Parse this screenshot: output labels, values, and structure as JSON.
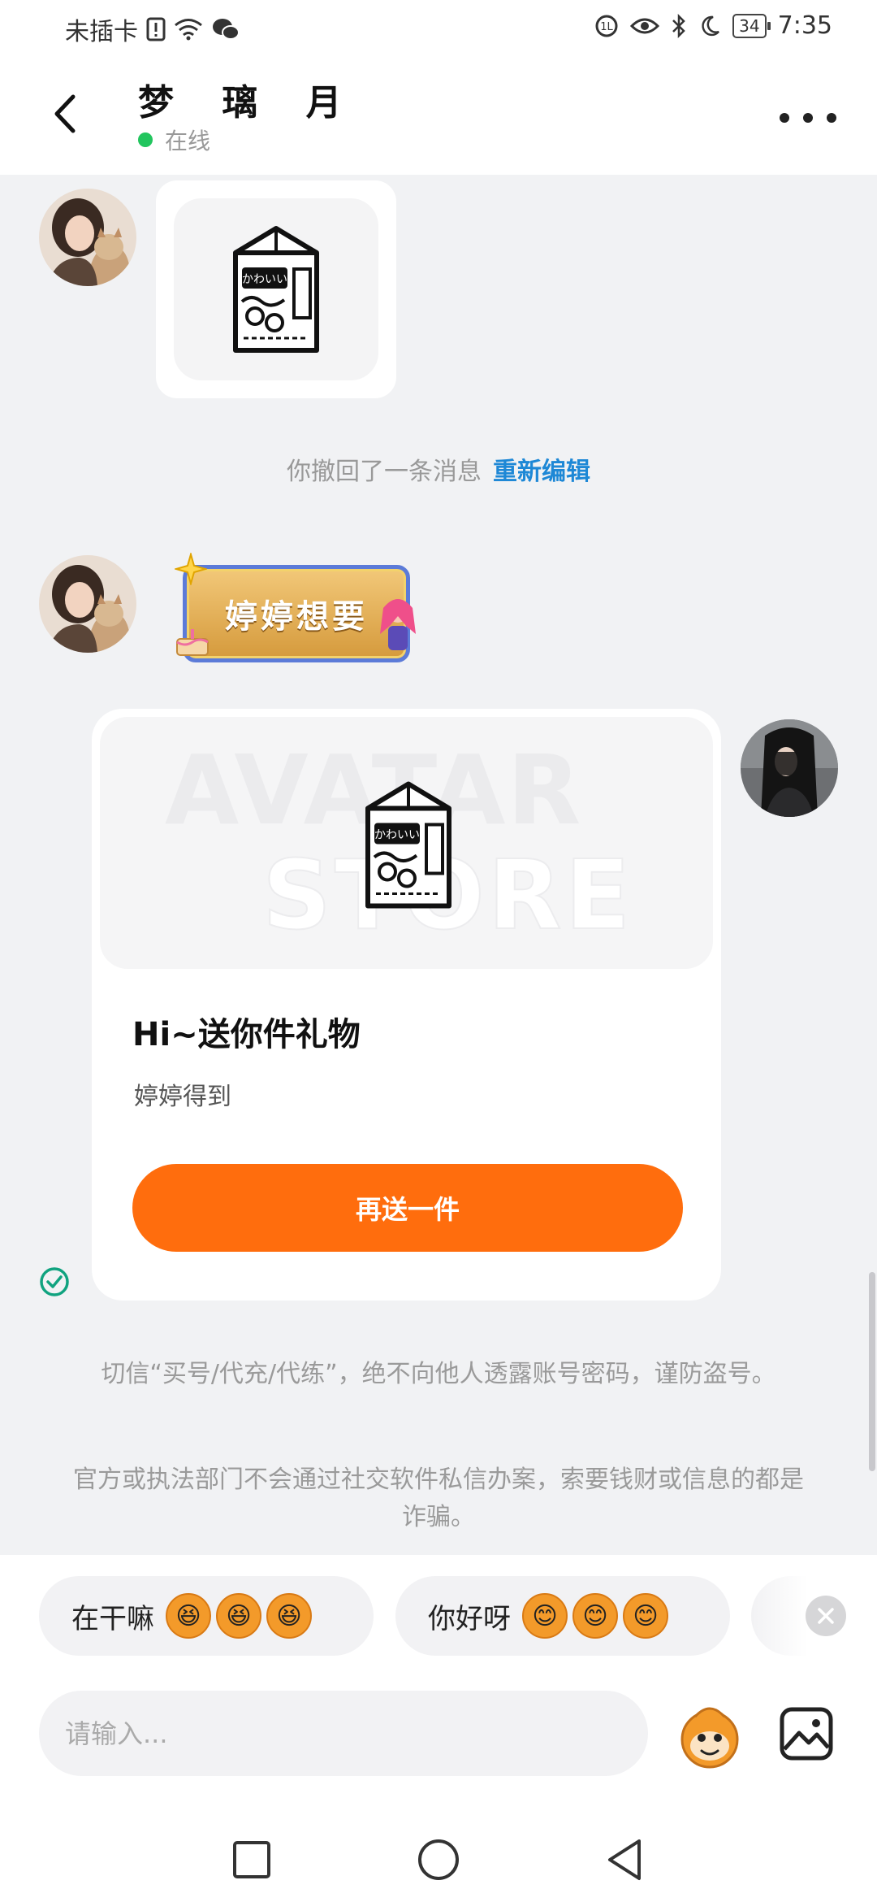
{
  "status_bar": {
    "carrier": "未插卡",
    "time": "7:35",
    "battery": "34"
  },
  "header": {
    "title": "梦 璃 月",
    "status": "在线"
  },
  "messages": {
    "recall_notice": "你撤回了一条消息",
    "recall_edit": "重新编辑",
    "badge_text": "婷婷想要",
    "gift_card": {
      "title": "Hi~送你件礼物",
      "subtitle": "婷婷得到",
      "button": "再送一件",
      "watermark_line1": "AVATAR",
      "watermark_line2": "STORE"
    }
  },
  "warnings": [
    "切信“买号/代充/代练”，绝不向他人透露账号密码，谨防盗号。",
    "官方或执法部门不会通过社交软件私信办案，索要钱财或信息的都是诈骗。"
  ],
  "quick_replies": [
    {
      "label": "在干嘛"
    },
    {
      "label": "你好呀"
    }
  ],
  "composer": {
    "placeholder": "请输入..."
  },
  "icons": {
    "back": "chevron-left-icon",
    "more": "more-dots-icon",
    "check": "check-circle-icon",
    "emoji": "emoji-icon",
    "image": "image-icon"
  },
  "colors": {
    "accent": "#ff6d0d",
    "link": "#1e88d6",
    "online": "#22c55e",
    "check": "#10a37f"
  }
}
